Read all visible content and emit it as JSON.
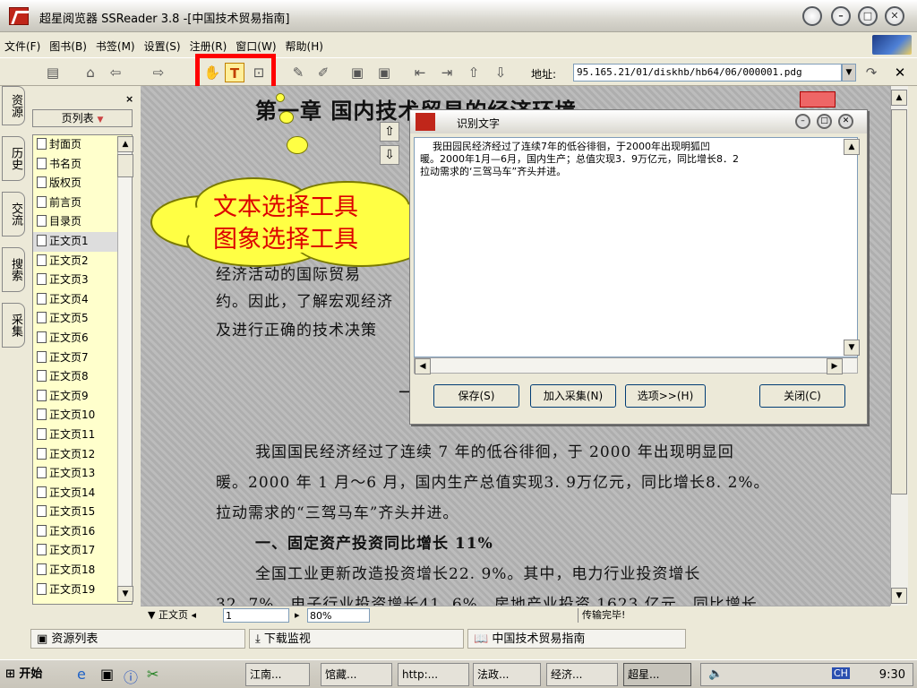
{
  "window": {
    "title": "超星阅览器 SSReader 3.8 -[中国技术贸易指南]",
    "min": "–",
    "restore": "▫",
    "max": "□",
    "close": "✕"
  },
  "menu": [
    "文件(F)",
    "图书(B)",
    "书签(M)",
    "设置(S)",
    "注册(R)",
    "窗口(W)",
    "帮助(H)"
  ],
  "toolbar": {
    "address_label": "地址:",
    "address_value": "95.165.21/01/diskhb/hb64/06/000001.pdg"
  },
  "sidetabs": [
    "资源",
    "历史",
    "交流",
    "搜索",
    "采集"
  ],
  "pagelist": {
    "header": "页列表",
    "items": [
      "封面页",
      "书名页",
      "版权页",
      "前言页",
      "目录页",
      "正文页1",
      "正文页2",
      "正文页3",
      "正文页4",
      "正文页5",
      "正文页6",
      "正文页7",
      "正文页8",
      "正文页9",
      "正文页10",
      "正文页11",
      "正文页12",
      "正文页13",
      "正文页14",
      "正文页15",
      "正文页16",
      "正文页17",
      "正文页18",
      "正文页19"
    ]
  },
  "doc": {
    "heading": "第一章  国内技术贸易的经济环境",
    "partial1": "经济活动的国际贸易",
    "partial2": "约。因此，了解宏观经济",
    "partial3": "及进行正确的技术决策",
    "sub": "一、",
    "para1": "我国国民经济经过了连续 7 年的低谷徘徊，于 2000 年出现明显回",
    "para2": "暖。2000 年 1 月～6 月，国内生产总值实现3. 9万亿元，同比增长8. 2%。",
    "para3": "拉动需求的“三驾马车”齐头并进。",
    "para4": "一、固定资产投资同比增长 11%",
    "para5": "全国工业更新改造投资增长22. 9%。其中，电力行业投资增长",
    "para6": "32. 7%，电子行业投资增长41. 6%，房地产业投资 1623 亿元，同比增长"
  },
  "bubble": {
    "line1": "文本选择工具",
    "line2": "图象选择工具"
  },
  "ocr": {
    "title": "识别文字",
    "text": "    我田园民经济经过了连续7年的低谷徘徊，于2000年出现明狐凹\n暖。2000年1月—6月，国内生产；总值灾现3．9万亿元，同比增长8．2\n拉动需求的‘三驾马车”齐头并进。",
    "save": "保存(S)",
    "add": "加入采集(N)",
    "options": "选项>>(H)",
    "close": "关闭(C)"
  },
  "status": {
    "page_type": "正文页",
    "page_num": "1",
    "zoom": "80%",
    "transfer": "传输完毕!"
  },
  "bottombar": {
    "resources": "资源列表",
    "download": "下载监视",
    "book": "中国技术贸易指南"
  },
  "taskbar": {
    "start": "开始",
    "tasks": [
      "江南...",
      "馆藏...",
      "http:...",
      "法政...",
      "经济...",
      "超星..."
    ],
    "clock": "9:30",
    "ime": "CH"
  }
}
